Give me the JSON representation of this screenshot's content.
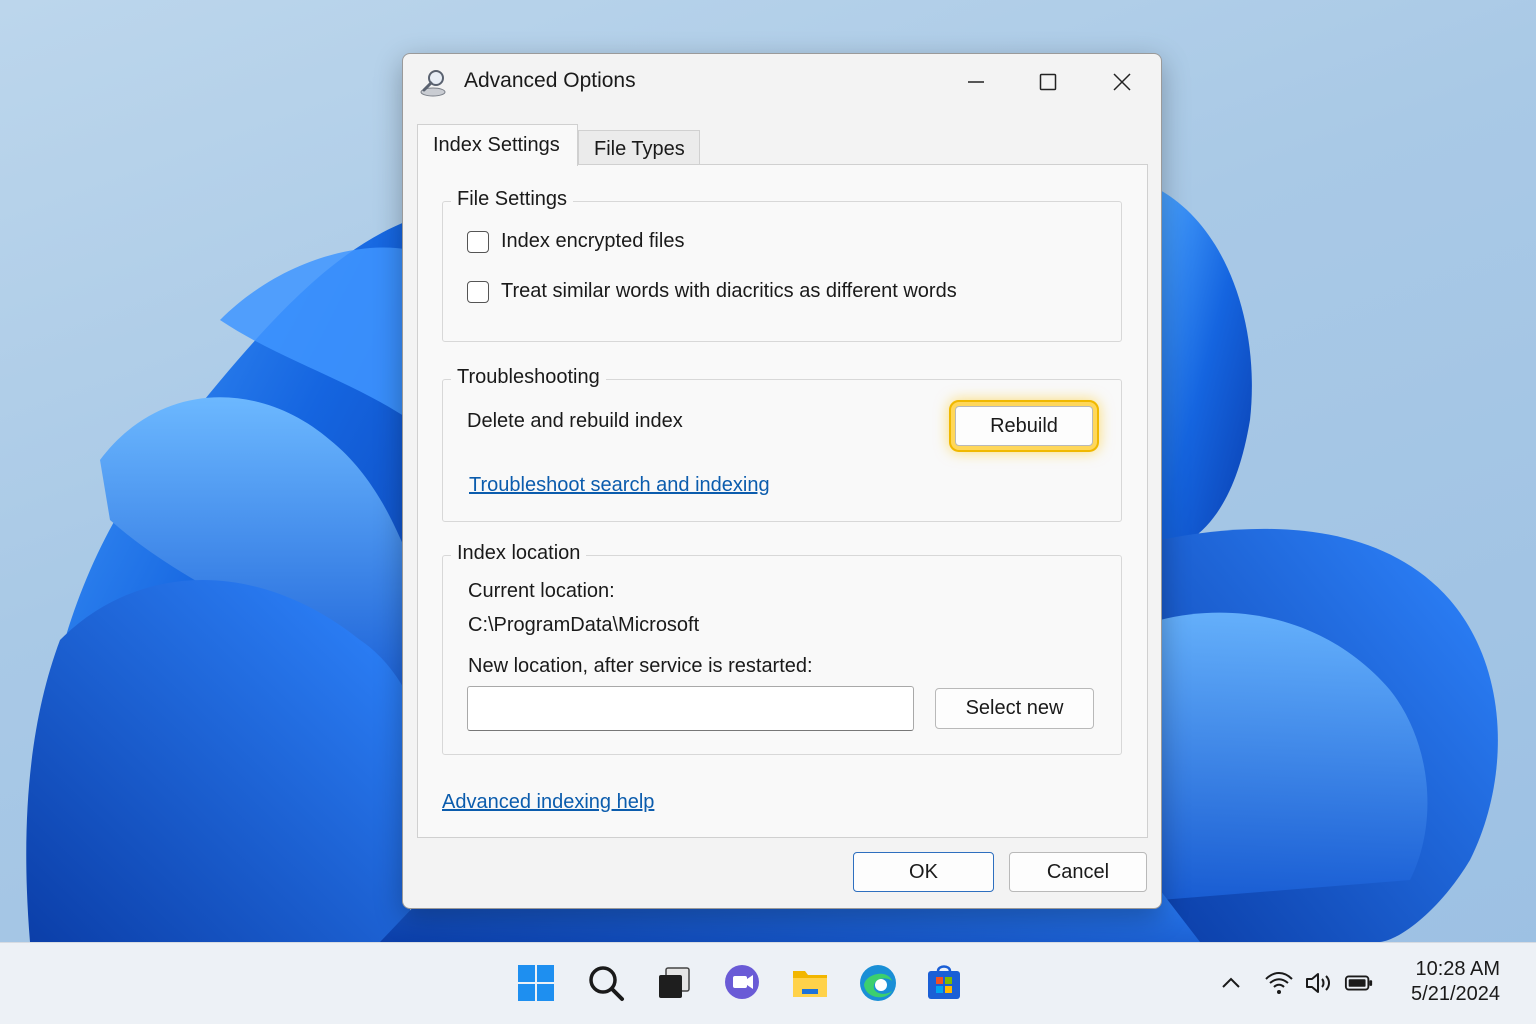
{
  "dialog": {
    "title": "Advanced Options",
    "tabs": [
      {
        "label": "Index Settings",
        "active": true
      },
      {
        "label": "File Types",
        "active": false
      }
    ],
    "file_settings": {
      "legend": "File Settings",
      "options": [
        {
          "label": "Index encrypted files",
          "checked": false
        },
        {
          "label": "Treat similar words with diacritics as different words",
          "checked": false
        }
      ]
    },
    "troubleshooting": {
      "legend": "Troubleshooting",
      "rebuild_text": "Delete and rebuild index",
      "rebuild_button": "Rebuild",
      "troubleshoot_link": "Troubleshoot search and indexing"
    },
    "index_location": {
      "legend": "Index location",
      "current_label": "Current location:",
      "current_path": "C:\\ProgramData\\Microsoft",
      "new_label": "New location, after service is restarted:",
      "new_value": "",
      "select_button": "Select new"
    },
    "help_link": "Advanced indexing help",
    "ok_button": "OK",
    "cancel_button": "Cancel"
  },
  "taskbar": {
    "apps": [
      "windows-start-icon",
      "search-icon",
      "task-view-icon",
      "teams-chat-icon",
      "file-explorer-icon",
      "edge-browser-icon",
      "microsoft-store-icon"
    ],
    "tray": [
      "chevron-up-icon",
      "wifi-icon",
      "volume-icon",
      "battery-icon"
    ],
    "time": "10:28 AM",
    "date": "5/21/2024"
  },
  "colors": {
    "accent": "#0b5cad",
    "highlight": "#f0b800",
    "wallpaper_blue": "#1565e0"
  }
}
